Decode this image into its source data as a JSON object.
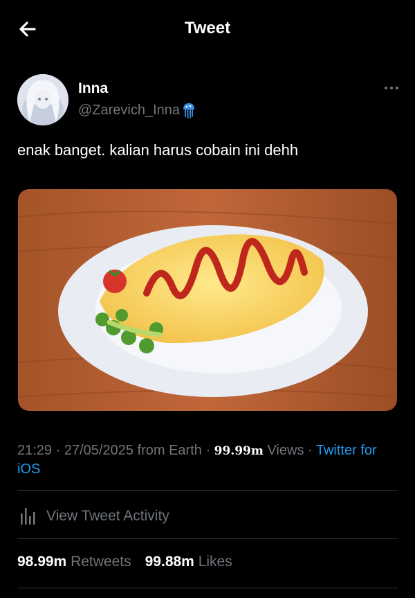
{
  "header": {
    "title": "Tweet"
  },
  "author": {
    "name": "Inna",
    "handle": "@Zarevich_Inna"
  },
  "tweet": {
    "text": "enak banget. kalian harus cobain ini dehh",
    "time": "21:29",
    "date": "27/05/2025",
    "location": "from Earth",
    "views_count": "99.99m",
    "views_label": "Views",
    "client": "Twitter for iOS"
  },
  "activity": {
    "label": "View Tweet Activity"
  },
  "stats": {
    "retweets_count": "98.99m",
    "retweets_label": "Retweets",
    "likes_count": "99.88m",
    "likes_label": "Likes"
  },
  "colors": {
    "background": "#000000",
    "accent": "#1d9bf0",
    "muted": "#71767b"
  },
  "icons": [
    "back-arrow-icon",
    "jellyfish-icon",
    "more-options-icon",
    "bar-chart-icon"
  ]
}
